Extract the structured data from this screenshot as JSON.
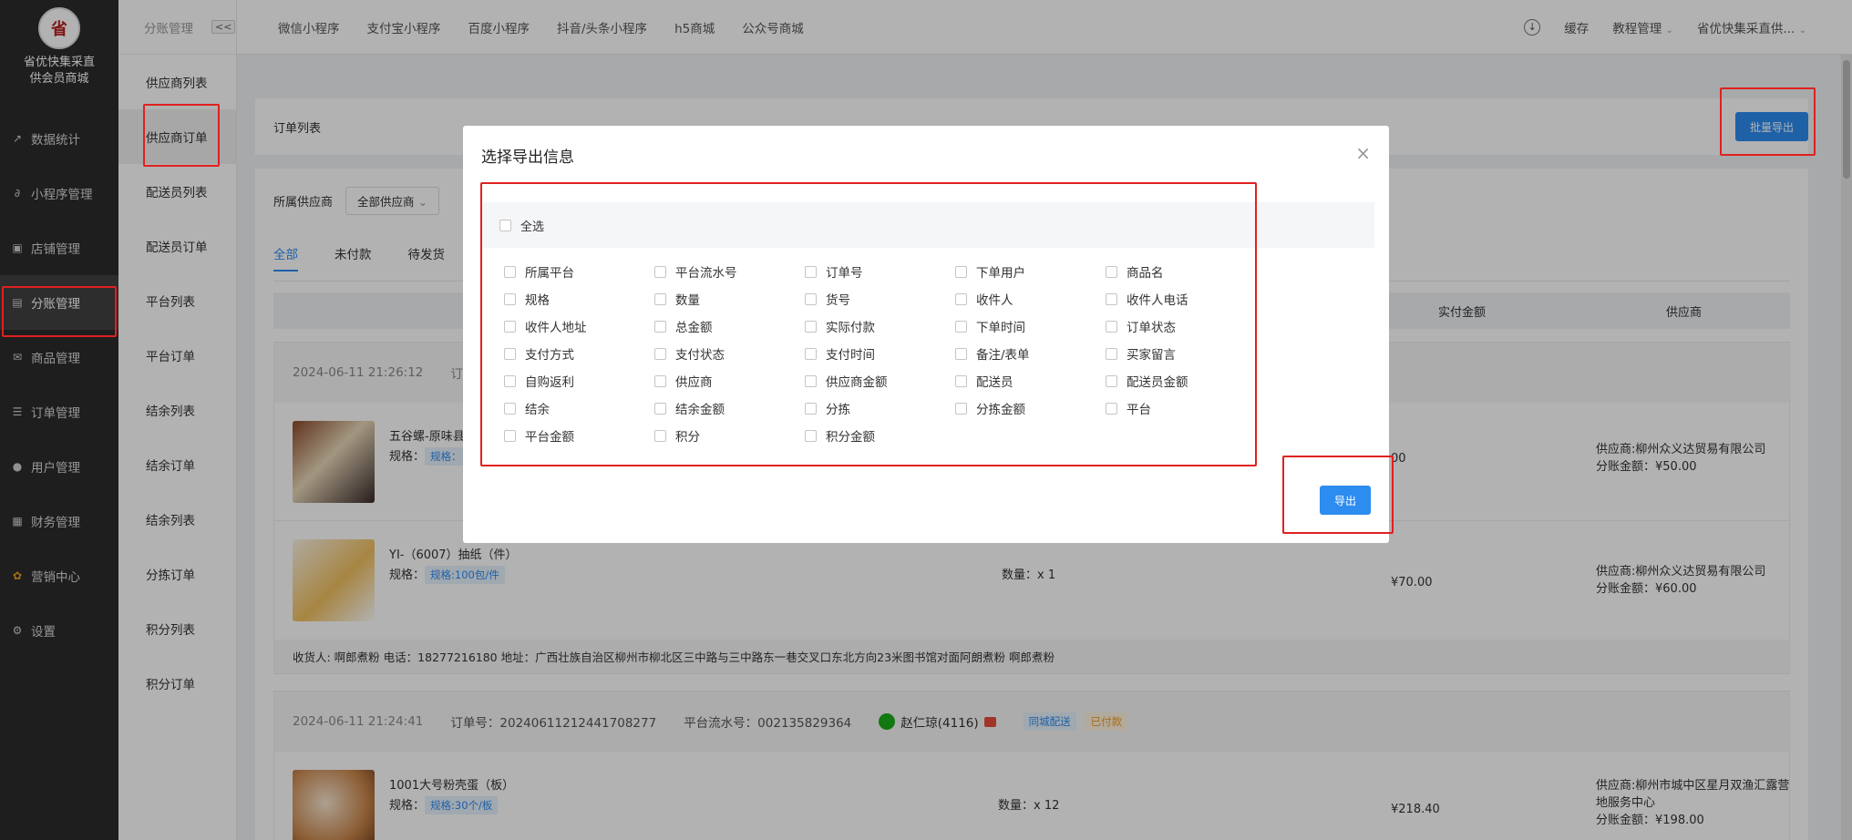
{
  "sidebar": {
    "logo_glyph": "省",
    "logo_sub": "优快",
    "logo_text": "省优快集采直供会员商城",
    "items": [
      {
        "label": "数据统计",
        "icon": "chart-line-icon"
      },
      {
        "label": "小程序管理",
        "icon": "link-icon"
      },
      {
        "label": "店铺管理",
        "icon": "store-icon"
      },
      {
        "label": "分账管理",
        "icon": "ledger-icon"
      },
      {
        "label": "商品管理",
        "icon": "mail-icon"
      },
      {
        "label": "订单管理",
        "icon": "list-icon"
      },
      {
        "label": "用户管理",
        "icon": "user-icon"
      },
      {
        "label": "财务管理",
        "icon": "finance-icon"
      },
      {
        "label": "营销中心",
        "icon": "marketing-icon"
      },
      {
        "label": "设置",
        "icon": "gear-icon"
      }
    ]
  },
  "subnav": {
    "title": "分账管理",
    "collapse": "<<",
    "items": [
      "供应商列表",
      "供应商订单",
      "配送员列表",
      "配送员订单",
      "平台列表",
      "平台订单",
      "结余列表",
      "结余订单",
      "结余列表",
      "分拣订单",
      "积分列表",
      "积分订单"
    ]
  },
  "topbar": {
    "tabs": [
      "微信小程序",
      "支付宝小程序",
      "百度小程序",
      "抖音/头条小程序",
      "h5商城",
      "公众号商城"
    ],
    "cache": "缓存",
    "tutorial": "教程管理",
    "account": "省优快集采直供..."
  },
  "page": {
    "title": "订单列表",
    "batch_export": "批量导出",
    "supplier_label": "所属供应商",
    "supplier_value": "全部供应商",
    "tabs": [
      "全部",
      "未付款",
      "待发货"
    ],
    "col_paid": "实付金额",
    "col_supplier": "供应商"
  },
  "orders": [
    {
      "date": "2024-06-11 21:26:12",
      "order_no_prefix": "订",
      "items": [
        {
          "name": "五谷螺-原味县",
          "spec_label": "规格：",
          "spec": "规格：",
          "amount": "00",
          "supplier": "供应商:柳州众义达贸易有限公司",
          "share": "分账金额：¥50.00"
        },
        {
          "name": "YI-（6007）抽纸（件）",
          "spec_label": "规格：",
          "spec": "规格:100包/件",
          "qty": "数量：x 1",
          "amount": "¥70.00",
          "supplier": "供应商:柳州众义达贸易有限公司",
          "share": "分账金额：¥60.00"
        }
      ],
      "receiver": "收货人: 啊郎煮粉 电话：18277216180 地址：广西壮族自治区柳州市柳北区三中路与三中路东一巷交叉口东北方向23米图书馆对面阿朗煮粉 啊郎煮粉"
    },
    {
      "date": "2024-06-11 21:24:41",
      "order_no": "订单号：20240611212441708277",
      "flow_no": "平台流水号：002135829364",
      "user": "赵仁琼(4116)",
      "delivery_tag": "同城配送",
      "status_tag": "已付款",
      "items": [
        {
          "name": "1001大号粉壳蛋（板）",
          "spec_label": "规格：",
          "spec": "规格:30个/板",
          "qty": "数量：x 12",
          "amount": "¥218.40",
          "supplier": "供应商:柳州市城中区星月双渔汇露营地服务中心",
          "share": "分账金额：¥198.00"
        }
      ]
    }
  ],
  "modal": {
    "title": "选择导出信息",
    "close": "×",
    "check_all": "全选",
    "fields": [
      "所属平台",
      "平台流水号",
      "订单号",
      "下单用户",
      "商品名",
      "规格",
      "数量",
      "货号",
      "收件人",
      "收件人电话",
      "收件人地址",
      "总金额",
      "实际付款",
      "下单时间",
      "订单状态",
      "支付方式",
      "支付状态",
      "支付时间",
      "备注/表单",
      "买家留言",
      "自购返利",
      "供应商",
      "供应商金额",
      "配送员",
      "配送员金额",
      "结余",
      "结余金额",
      "分拣",
      "分拣金额",
      "平台",
      "平台金额",
      "积分",
      "积分金额"
    ],
    "export": "导出"
  },
  "colors": {
    "accent": "#2d8cf0",
    "highlight": "#e02020",
    "sidebar": "#2b2b2b"
  }
}
